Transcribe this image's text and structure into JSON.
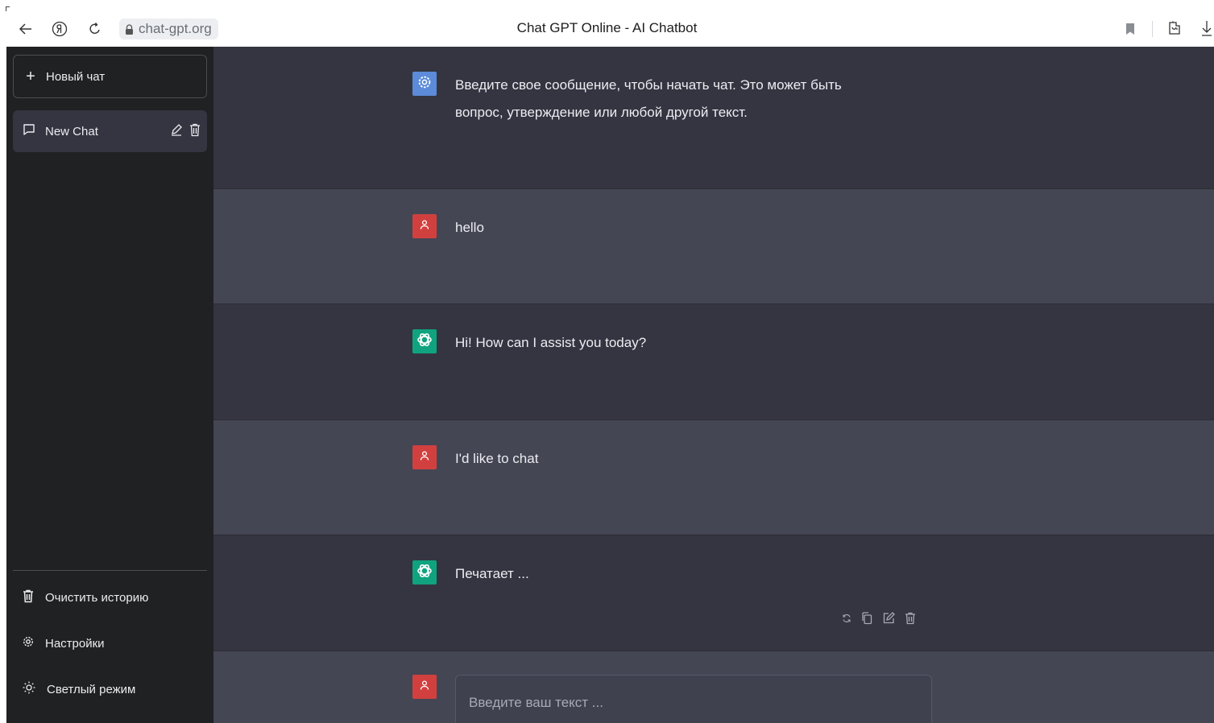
{
  "browser": {
    "url": "chat-gpt.org",
    "page_title": "Chat GPT Online - AI Chatbot"
  },
  "sidebar": {
    "new_chat_label": "Новый чат",
    "chats": [
      {
        "label": "New Chat"
      }
    ],
    "footer": {
      "clear_history": "Очистить историю",
      "settings": "Настройки",
      "light_mode": "Светлый режим"
    }
  },
  "messages": [
    {
      "role": "system",
      "text": "Введите свое сообщение, чтобы начать чат. Это может быть вопрос, утверждение или любой другой текст."
    },
    {
      "role": "user",
      "text": "hello"
    },
    {
      "role": "assistant",
      "text": "Hi! How can I assist you today?"
    },
    {
      "role": "user",
      "text": "I'd like to chat"
    },
    {
      "role": "assistant",
      "text": "Печатает ..."
    }
  ],
  "composer": {
    "placeholder": "Введите ваш текст ..."
  },
  "colors": {
    "sidebar_bg": "#202123",
    "chat_dark_bg": "#343541",
    "chat_light_bg": "#444654",
    "user_avatar": "#d1403f",
    "bot_avatar": "#10a37f",
    "system_avatar": "#5b8bd9"
  },
  "icons": {
    "back": "arrow-left-icon",
    "yandex": "yandex-logo-icon",
    "reload": "reload-icon",
    "lock": "lock-icon",
    "bookmark": "bookmark-icon",
    "extensions": "extensions-icon",
    "download": "download-icon",
    "message_actions": [
      "regenerate-icon",
      "copy-icon",
      "edit-icon",
      "delete-icon"
    ]
  }
}
